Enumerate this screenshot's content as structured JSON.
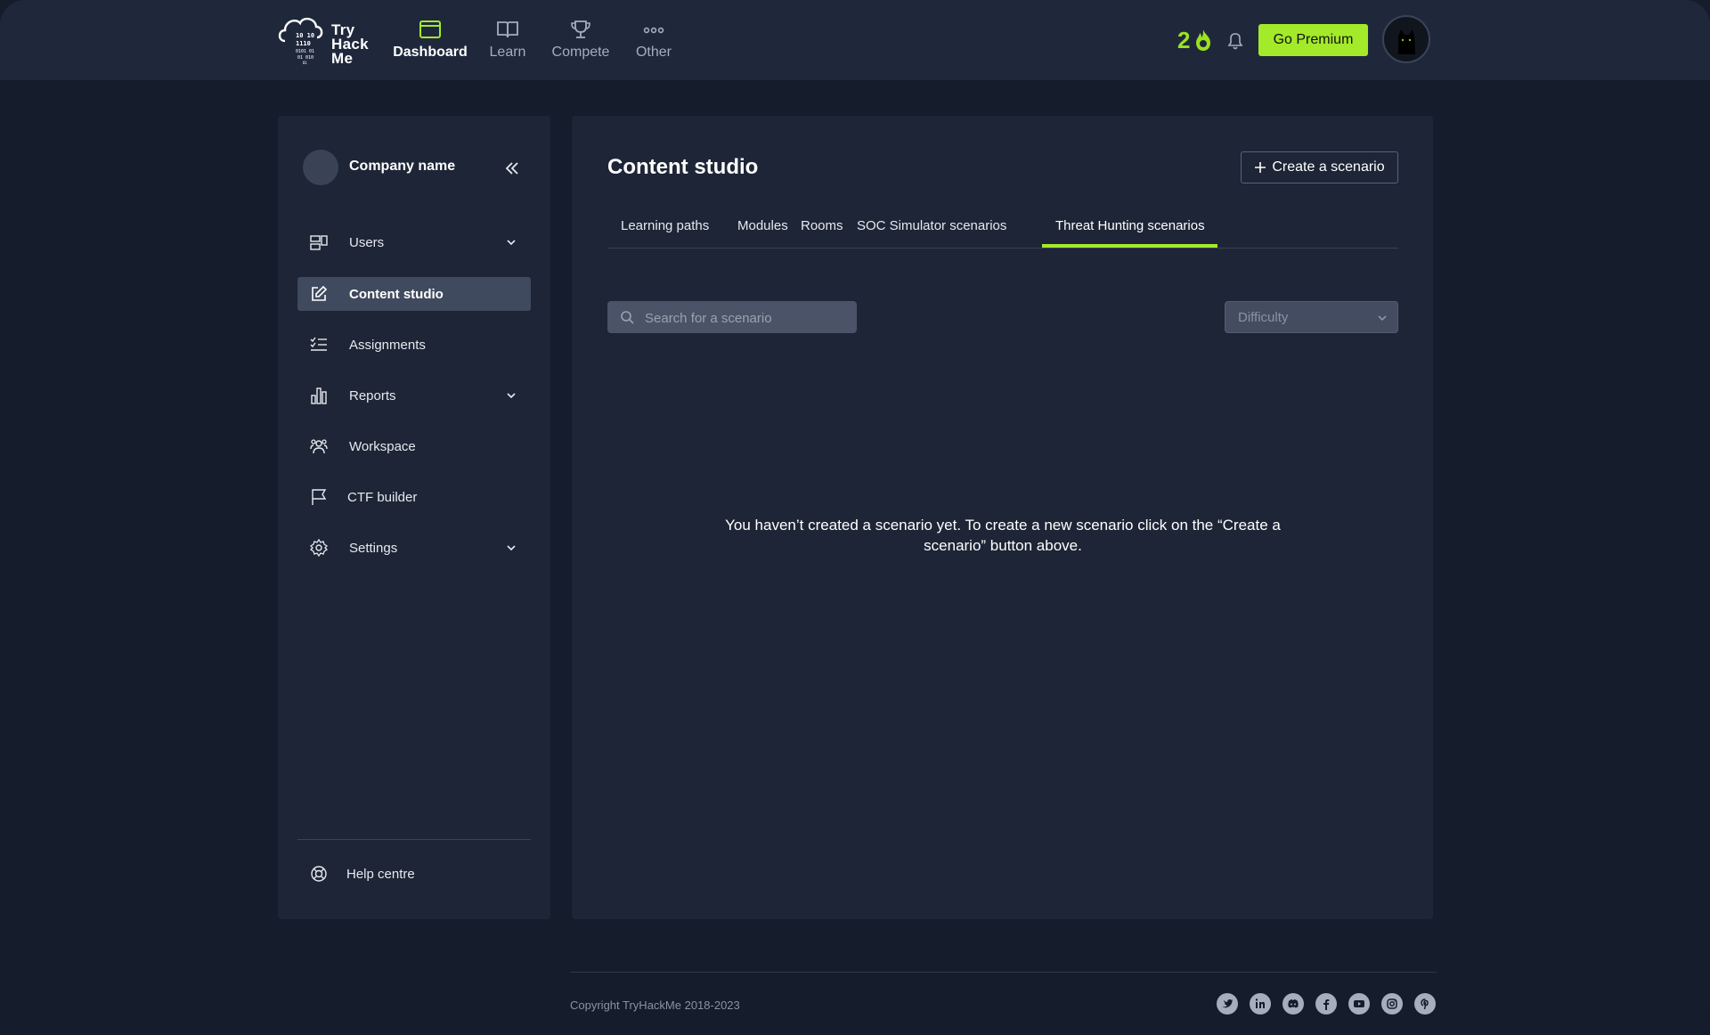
{
  "logo": {
    "lines": [
      "Try",
      "Hack",
      "Me"
    ]
  },
  "nav": {
    "items": [
      {
        "label": "Dashboard",
        "icon": "browser-window-icon",
        "active": true
      },
      {
        "label": "Learn",
        "icon": "book-icon",
        "active": false
      },
      {
        "label": "Compete",
        "icon": "trophy-icon",
        "active": false
      },
      {
        "label": "Other",
        "icon": "dots-icon",
        "active": false
      }
    ],
    "streak_count": "2",
    "premium_label": "Go Premium"
  },
  "sidebar": {
    "company_name": "Company name",
    "items": [
      {
        "label": "Users",
        "icon": "users-icon",
        "has_children": true
      },
      {
        "label": "Content studio",
        "icon": "edit-icon",
        "active": true
      },
      {
        "label": "Assignments",
        "icon": "checklist-icon"
      },
      {
        "label": "Reports",
        "icon": "bar-chart-icon",
        "has_children": true
      },
      {
        "label": "Workspace",
        "icon": "team-icon"
      },
      {
        "label": "CTF builder",
        "icon": "flag-icon"
      },
      {
        "label": "Settings",
        "icon": "gear-icon",
        "has_children": true
      }
    ],
    "help_label": "Help centre"
  },
  "main": {
    "title": "Content studio",
    "create_label": "Create a scenario",
    "tabs": [
      {
        "label": "Learning paths"
      },
      {
        "label": "Modules"
      },
      {
        "label": "Rooms"
      },
      {
        "label": "SOC Simulator scenarios"
      },
      {
        "label": "Threat Hunting scenarios",
        "active": true
      }
    ],
    "search_placeholder": "Search for a scenario",
    "difficulty_label": "Difficulty",
    "empty_line1": "You haven’t created a scenario yet. To create a new scenario click on the “Create a",
    "empty_line2": "scenario” button above."
  },
  "footer": {
    "copyright": "Copyright TryHackMe 2018-2023",
    "socials": [
      "twitter-icon",
      "linkedin-icon",
      "discord-icon",
      "facebook-icon",
      "youtube-icon",
      "instagram-icon",
      "pinterest-icon"
    ]
  },
  "colors": {
    "accent": "#a3ea2a",
    "background": "#151c2b",
    "panel": "#1d2536",
    "topbar": "#1f283b"
  }
}
